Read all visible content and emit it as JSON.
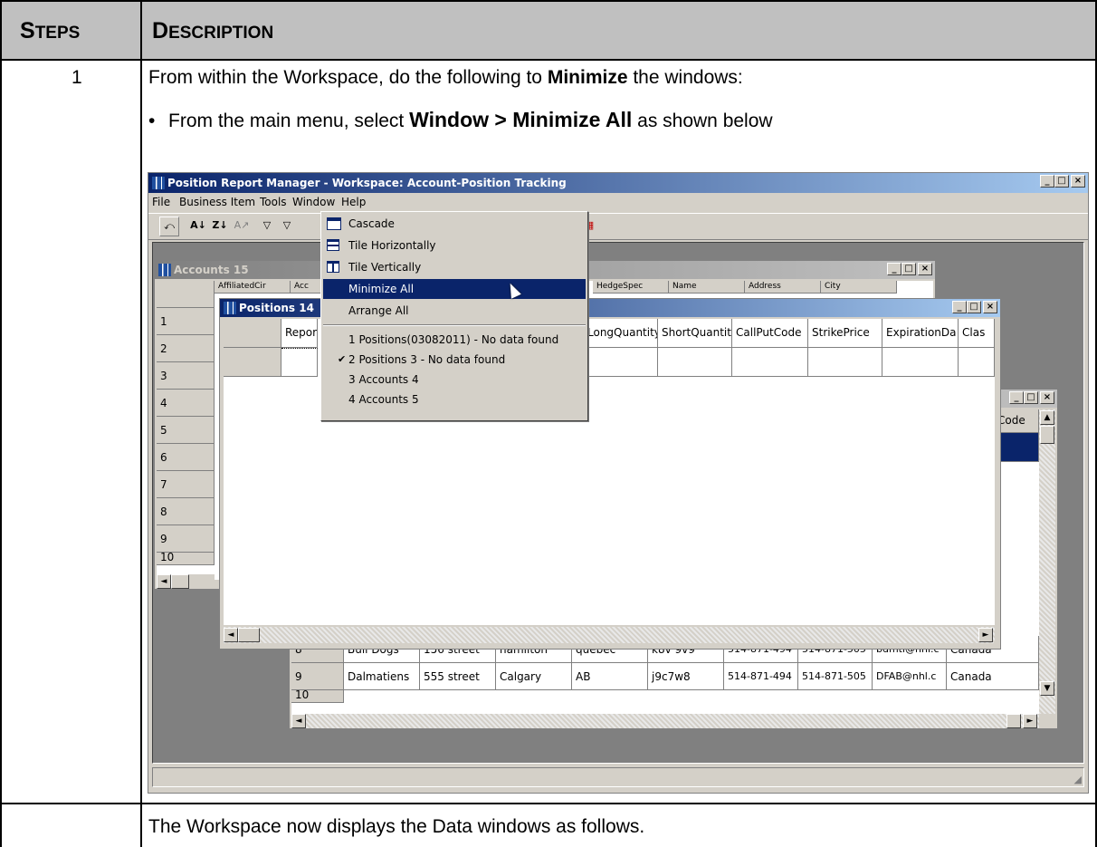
{
  "doc": {
    "col1_header_first": "S",
    "col1_header_rest": "TEPS",
    "col2_header_first": "D",
    "col2_header_rest": "ESCRIPTION",
    "step_number": "1",
    "intro_pre": "From within the Workspace, do the following to ",
    "intro_bold": "Minimize",
    "intro_post": " the windows:",
    "bullet_pre": "From the main menu, select ",
    "bullet_bold": "Window > Minimize All",
    "bullet_post": " as shown below",
    "footer_text": "The Workspace now displays the Data windows as follows."
  },
  "app": {
    "title": "Position Report Manager - Workspace: Account-Position Tracking",
    "menubar": [
      "File",
      "Business Item",
      "Tools",
      "Window",
      "Help"
    ],
    "window_menu": {
      "items": [
        "Cascade",
        "Tile Horizontally",
        "Tile Vertically",
        "Minimize All",
        "Arrange All"
      ],
      "window_list": [
        "1 Positions(03082011) - No data found",
        "2 Positions 3 - No data found",
        "3 Accounts 4",
        "4 Accounts 5"
      ],
      "selected": "Minimize All",
      "checked": "2 Positions 3 - No data found"
    },
    "accounts15": {
      "title": "Accounts 15",
      "col_headers": [
        "AffiliatedCir",
        "Acc",
        "HedgeSpec",
        "Name",
        "Address",
        "City"
      ],
      "row_numbers": [
        "1",
        "2",
        "3",
        "4",
        "5",
        "6",
        "7",
        "8",
        "9",
        "10"
      ]
    },
    "positions14": {
      "title": "Positions 14",
      "col_headers": [
        "Repor",
        "LongQuantity",
        "ShortQuantit",
        "CallPutCode",
        "StrikePrice",
        "ExpirationDa",
        "Clas"
      ]
    },
    "accounts_back": {
      "col_header_partial": "Code",
      "rows": [
        {
          "num": "8",
          "name": "Bull Dogs",
          "street": "156 street",
          "city": "hamilton",
          "prov": "quebec",
          "postal": "k8v 9v9",
          "phone1": "514-871-494",
          "phone2": "514-871-505",
          "email": "bdmtl@nhl.c",
          "country": "Canada"
        },
        {
          "num": "9",
          "name": "Dalmatiens",
          "street": "555 street",
          "city": "Calgary",
          "prov": "AB",
          "postal": "j9c7w8",
          "phone1": "514-871-494",
          "phone2": "514-871-505",
          "email": "DFAB@nhl.c",
          "country": "Canada"
        }
      ],
      "partial_row_num": "10"
    }
  }
}
